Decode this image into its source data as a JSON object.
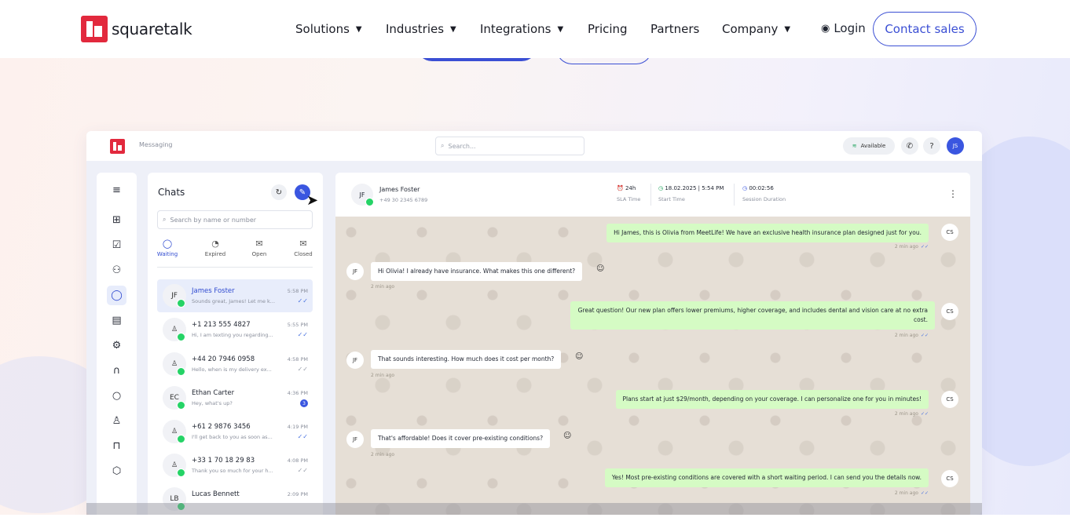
{
  "brand": {
    "name": "squaretalk"
  },
  "nav": {
    "solutions": "Solutions",
    "industries": "Industries",
    "integrations": "Integrations",
    "pricing": "Pricing",
    "partners": "Partners",
    "company": "Company",
    "login": "Login",
    "contact_sales": "Contact sales"
  },
  "app": {
    "title": "Messaging",
    "search_placeholder": "Search...",
    "status": "Available",
    "user_initials": "JS"
  },
  "chats": {
    "title": "Chats",
    "search_placeholder": "Search by name or number",
    "tabs": [
      {
        "label": "Waiting",
        "icon": "chat-bubble-icon"
      },
      {
        "label": "Expired",
        "icon": "clock-icon"
      },
      {
        "label": "Open",
        "icon": "open-envelope-icon"
      },
      {
        "label": "Closed",
        "icon": "closed-envelope-icon"
      }
    ],
    "items": [
      {
        "avatar": "JF",
        "name": "James Foster",
        "snippet": "Sounds great, James! Let me k...",
        "time": "5:58 PM",
        "status": "read"
      },
      {
        "avatar": "",
        "name": "+1 213 555 4827",
        "snippet": "Hi, I am texting you regarding...",
        "time": "5:55 PM",
        "status": "read"
      },
      {
        "avatar": "",
        "name": "+44 20 7946 0958",
        "snippet": "Hello, when is my delivery ex...",
        "time": "4:58 PM",
        "status": "sent"
      },
      {
        "avatar": "EC",
        "name": "Ethan Carter",
        "snippet": "Hey, what's up?",
        "time": "4:36 PM",
        "unread": "3"
      },
      {
        "avatar": "",
        "name": "+61 2 9876 3456",
        "snippet": "I'll get back to you as soon as...",
        "time": "4:19 PM",
        "status": "read"
      },
      {
        "avatar": "",
        "name": "+33 1 70 18 29 83",
        "snippet": "Thank you so much for your h...",
        "time": "4:08 PM",
        "status": "sent"
      },
      {
        "avatar": "LB",
        "name": "Lucas Bennett",
        "snippet": "",
        "time": "2:09 PM",
        "status": "sent"
      }
    ]
  },
  "conversation": {
    "contact_initials": "JF",
    "contact_name": "James Foster",
    "contact_phone": "+49 30 2345 6789",
    "sla_value": "24h",
    "sla_label": "SLA Time",
    "start_value": "18.02.2025 | 5:54 PM",
    "start_label": "Start Time",
    "duration_value": "00:02:56",
    "duration_label": "Session Duration",
    "messages": [
      {
        "dir": "out",
        "avatar": "CS",
        "text": "Hi James, this is Olivia from MeetLife! We have an exclusive health insurance plan designed just for you.",
        "time": "2 min ago"
      },
      {
        "dir": "in",
        "avatar": "JF",
        "text": "Hi Olivia! I already have insurance. What makes this one different?",
        "time": "2 min ago"
      },
      {
        "dir": "out",
        "avatar": "CS",
        "text": "Great question! Our new plan offers lower premiums, higher coverage, and includes dental and vision care at no extra cost.",
        "time": "2 min ago"
      },
      {
        "dir": "in",
        "avatar": "JF",
        "text": "That sounds interesting. How much does it cost per month?",
        "time": "2 min ago"
      },
      {
        "dir": "out",
        "avatar": "CS",
        "text": "Plans start at just $29/month, depending on your coverage. I can personalize one for you in minutes!",
        "time": "2 min ago"
      },
      {
        "dir": "in",
        "avatar": "JF",
        "text": "That's affordable! Does it cover pre-existing conditions?",
        "time": "2 min ago"
      },
      {
        "dir": "out",
        "avatar": "CS",
        "text": "Yes! Most pre-existing conditions are covered with a short waiting period. I can send you the details now.",
        "time": "2 min ago"
      }
    ]
  },
  "colors": {
    "brand_red": "#e2293d",
    "accent_blue": "#3b4fd4",
    "whatsapp_green": "#25d366",
    "out_bubble": "#d5fbc4"
  }
}
